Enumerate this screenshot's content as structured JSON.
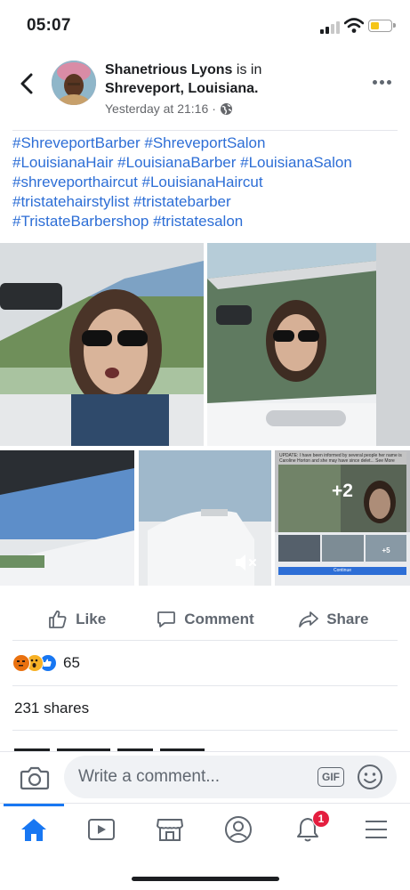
{
  "status_bar": {
    "time": "05:07"
  },
  "post": {
    "author": "Shanetrious Lyons",
    "is_in": "is in",
    "place": "Shreveport, Louisiana.",
    "timestamp": "Yesterday at 21:16",
    "separator": "·",
    "privacy_icon": "globe-icon",
    "hashtag_lines": [
      "#ShreveportBarber #ShreveportSalon",
      "#LouisianaHair #LouisianaBarber #LouisianaSalon",
      "#shreveporthaircut #LouisianaHaircut",
      "#tristatehairstylist  #tristatebarber",
      "#TristateBarbershop #tristatesalon"
    ],
    "photos": {
      "more_count": "+2",
      "update_caption": "UPDATE: I have been informed by several people her name is Caroline Horton and she may have since delet... See More",
      "inner_more_count": "+5",
      "continue_label": "Continue"
    }
  },
  "actions": {
    "like": "Like",
    "comment": "Comment",
    "share": "Share"
  },
  "reactions": {
    "count": "65",
    "types": [
      "angry",
      "wow",
      "like"
    ]
  },
  "shares": "231 shares",
  "comment_bar": {
    "placeholder": "Write a comment...",
    "gif_label": "GIF"
  },
  "tab_bar": {
    "notifications_badge": "1"
  },
  "colors": {
    "link": "#2d6ed6",
    "accent": "#1877f2",
    "badge": "#e41e3f"
  }
}
